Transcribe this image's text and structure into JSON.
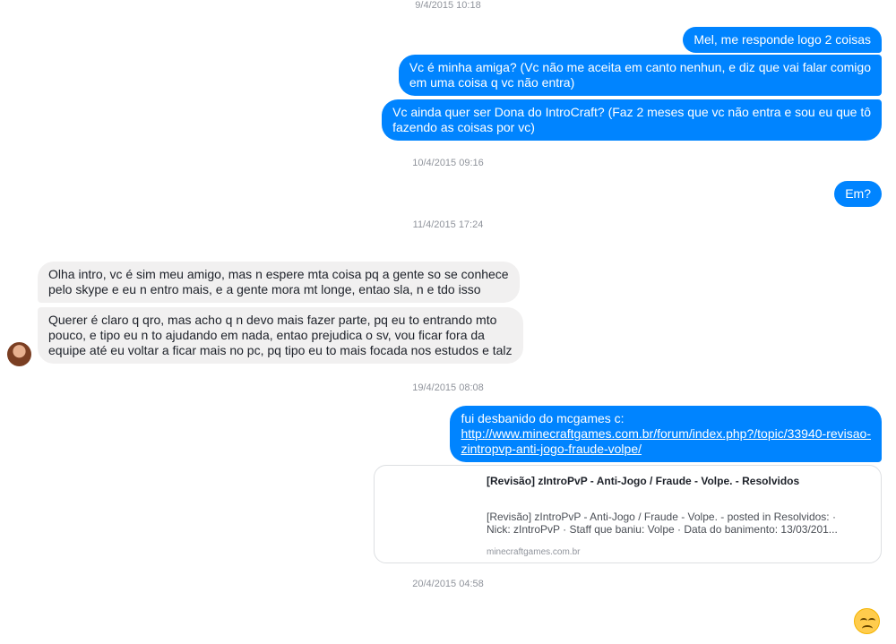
{
  "timestamps": [
    "9/4/2015 10:18",
    "10/4/2015 09:16",
    "11/4/2015 17:24",
    "19/4/2015 08:08",
    "20/4/2015 04:58"
  ],
  "msg1": {
    "lines": [
      "Mel, me responde logo 2 coisas"
    ]
  },
  "msg2": {
    "lines": [
      "Vc é minha amiga? (Vc não me aceita em canto nenhun, e diz que vai falar comigo",
      "em uma coisa q vc não entra)"
    ]
  },
  "msg3": {
    "lines": [
      "Vc ainda quer ser Dona do IntroCraft? (Faz 2 meses que vc não entra e sou eu que tô",
      "fazendo as coisas por vc)"
    ]
  },
  "msg4": {
    "lines": [
      "Em?"
    ]
  },
  "msg5": {
    "lines": [
      "Olha intro, vc é sim meu amigo, mas n espere mta coisa pq a gente so se conhece",
      "pelo skype e eu n entro mais, e a gente mora mt longe, entao sla, n e tdo isso"
    ]
  },
  "msg6": {
    "lines": [
      "Querer é claro q qro, mas acho q n devo mais fazer parte, pq eu to entrando mto",
      "pouco, e tipo eu n to ajudando em nada, entao prejudica o sv, vou ficar fora da",
      "equipe até eu voltar a ficar mais no pc, pq tipo eu to mais focada nos estudos e talz"
    ]
  },
  "msg7": {
    "text": "fui desbanido do mcgames c:",
    "link_lines": [
      "http://www.minecraftgames.com.br/forum/index.php?/topic/33940-revisao-",
      "zintropvp-anti-jogo-fraude-volpe/"
    ]
  },
  "link_card": {
    "title": "[Revisão] zIntroPvP - Anti-Jogo / Fraude - Volpe. - Resolvidos",
    "desc_lines": [
      "[Revisão] zIntroPvP - Anti-Jogo / Fraude - Volpe. - posted in Resolvidos: ·",
      "Nick: zIntroPvP · Staff que baniu: Volpe · Data do banimento: 13/03/201..."
    ],
    "domain": "minecraftgames.com.br"
  },
  "last_message_emoji": "disappointed-face-icon",
  "colors": {
    "outgoing": "#0084ff",
    "incoming": "#f1f0f0",
    "timestamp": "#90949c"
  }
}
